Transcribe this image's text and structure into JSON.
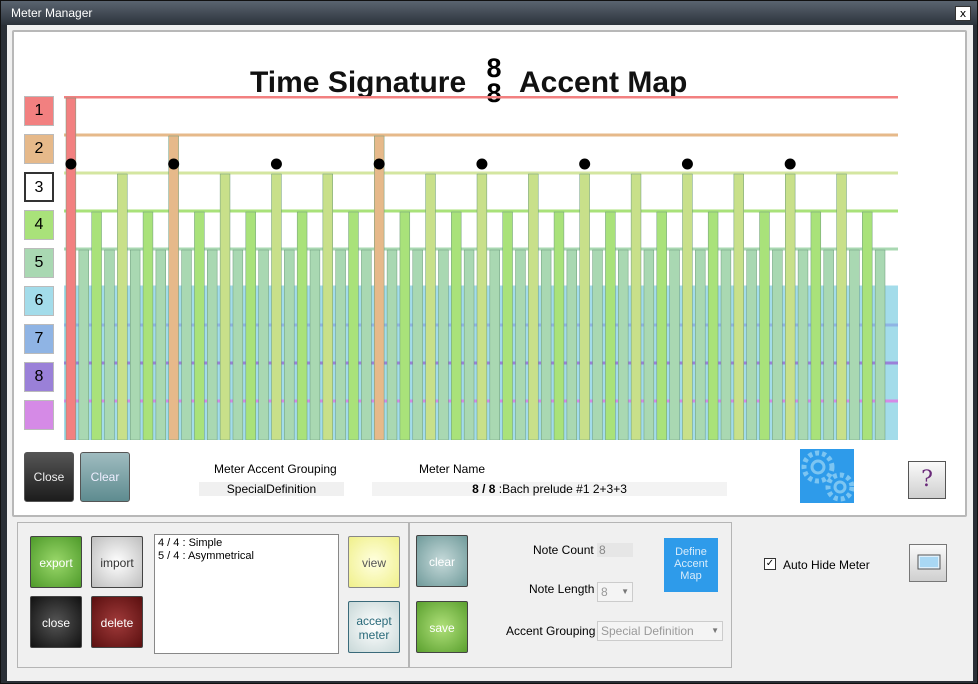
{
  "window": {
    "title": "Meter Manager",
    "close_glyph": "x"
  },
  "heading": {
    "left": "Time Signature",
    "numerator": "8",
    "denominator": "8",
    "right": "Accent Map"
  },
  "levels": [
    {
      "label": "1",
      "color": "#f28080"
    },
    {
      "label": "2",
      "color": "#e6b98a"
    },
    {
      "label": "3",
      "color": "#ffffff"
    },
    {
      "label": "4",
      "color": "#a9e27a"
    },
    {
      "label": "5",
      "color": "#a9d8b2"
    },
    {
      "label": "6",
      "color": "#a3dcea"
    },
    {
      "label": "7",
      "color": "#8fb4e4"
    },
    {
      "label": "8",
      "color": "#9a80d8"
    },
    {
      "label": "",
      "color": "#d58ae6"
    }
  ],
  "accent_map": {
    "note_count": 64,
    "beat_levels": [
      1,
      5,
      4,
      5,
      3,
      5,
      4,
      5,
      2,
      5,
      4,
      5,
      3,
      5,
      4,
      5,
      3,
      5,
      4,
      5,
      3,
      5,
      4,
      5,
      2,
      5,
      4,
      5,
      3,
      5,
      4,
      5,
      3,
      5,
      4,
      5,
      3,
      5,
      4,
      5,
      3,
      5,
      4,
      5,
      3,
      5,
      4,
      5,
      3,
      5,
      4,
      5,
      3,
      5,
      4,
      5,
      3,
      5,
      4,
      5,
      3,
      5,
      4,
      5
    ],
    "dots_at": [
      0,
      8,
      16,
      24,
      32,
      40,
      48,
      56
    ],
    "colors": {
      "1": "#f28080",
      "2": "#e6b98a",
      "3": "#c8e08a",
      "4": "#a9e27a",
      "5": "#a9d8b2"
    }
  },
  "top_buttons": {
    "close": "Close",
    "clear": "Clear",
    "help": "?"
  },
  "meter_accent_grouping": {
    "label": "Meter  Accent Grouping",
    "value": "SpecialDefinition"
  },
  "meter_name": {
    "label": "Meter Name",
    "bold_prefix": "8 / 8",
    "value": " :Bach prelude #1 2+3+3"
  },
  "library": {
    "export": "export",
    "import": "import",
    "close": "close",
    "delete": "delete",
    "items": [
      "4 / 4 : Simple",
      "5 / 4 : Asymmetrical"
    ],
    "view": "view",
    "accept_meter_line1": "accept",
    "accept_meter_line2": "meter"
  },
  "editor": {
    "clear": "clear",
    "save": "save",
    "note_count_label": "Note Count",
    "note_count_value": "8",
    "note_length_label": "Note Length",
    "note_length_value": "8",
    "accent_grouping_label": "Accent Grouping",
    "accent_grouping_value": "Special Definition",
    "define_line1": "Define",
    "define_line2": "Accent",
    "define_line3": "Map"
  },
  "options": {
    "auto_hide_label": "Auto Hide Meter",
    "auto_hide_checked": "✓"
  }
}
